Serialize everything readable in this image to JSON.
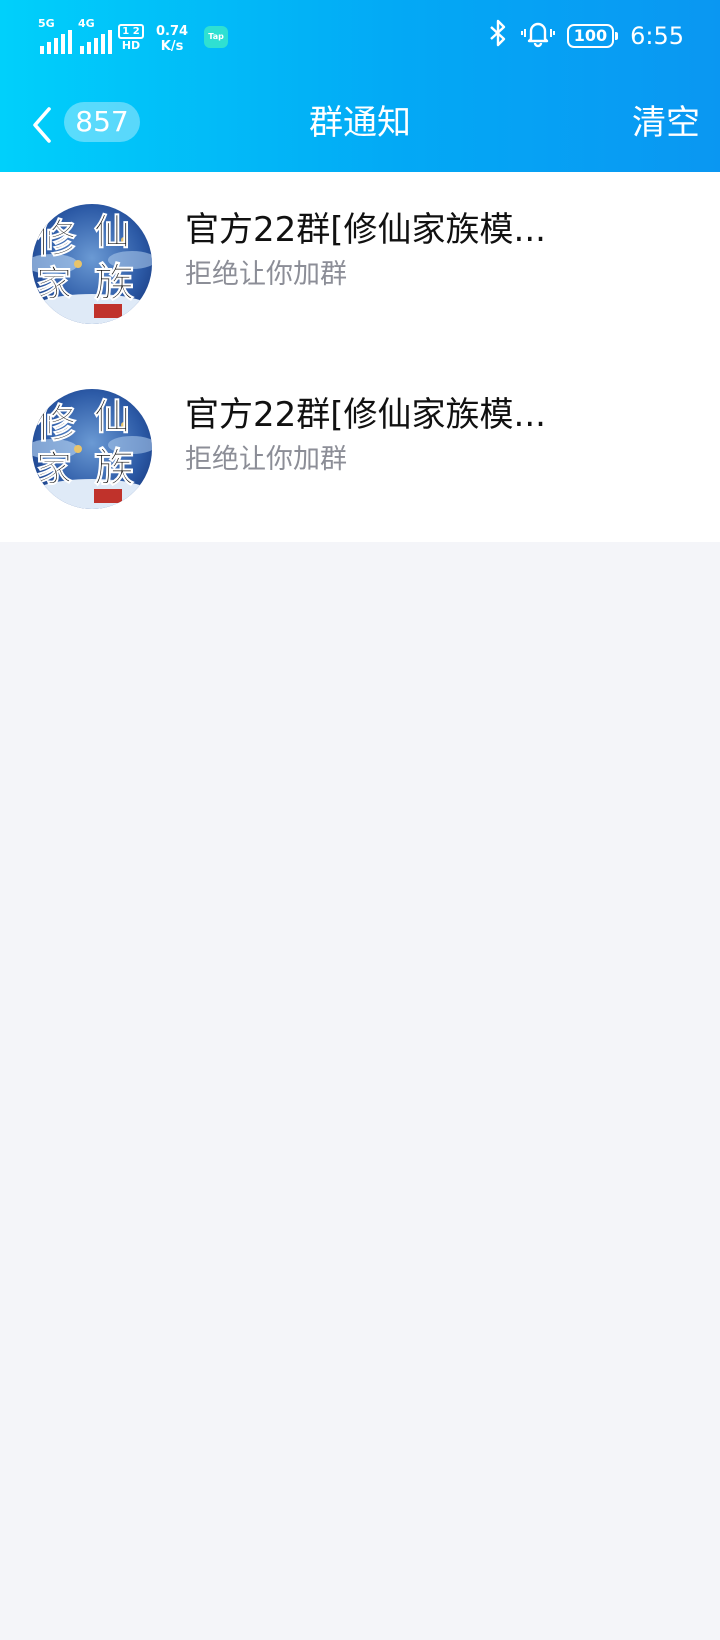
{
  "status_bar": {
    "network1": "5G",
    "network2": "4G",
    "hd_top": "1 2",
    "hd_bottom": "HD",
    "speed_value": "0.74",
    "speed_unit": "K/s",
    "app_badge": "Tap",
    "battery": "100",
    "time": "6:55",
    "icons": [
      "signal-icon",
      "bluetooth-icon",
      "vibrate-bell-icon",
      "battery-icon"
    ]
  },
  "nav": {
    "unread_count": "857",
    "title": "群通知",
    "clear_label": "清空"
  },
  "notifications": [
    {
      "group_name": "官方22群[修仙家族模...",
      "message": "拒绝让你加群",
      "avatar_text": "修仙家族"
    },
    {
      "group_name": "官方22群[修仙家族模...",
      "message": "拒绝让你加群",
      "avatar_text": "修仙家族"
    }
  ],
  "colors": {
    "header_gradient_start": "#00d0fb",
    "header_gradient_end": "#0a97f2",
    "page_background": "#f4f5f9",
    "secondary_text": "#8c8e97"
  }
}
